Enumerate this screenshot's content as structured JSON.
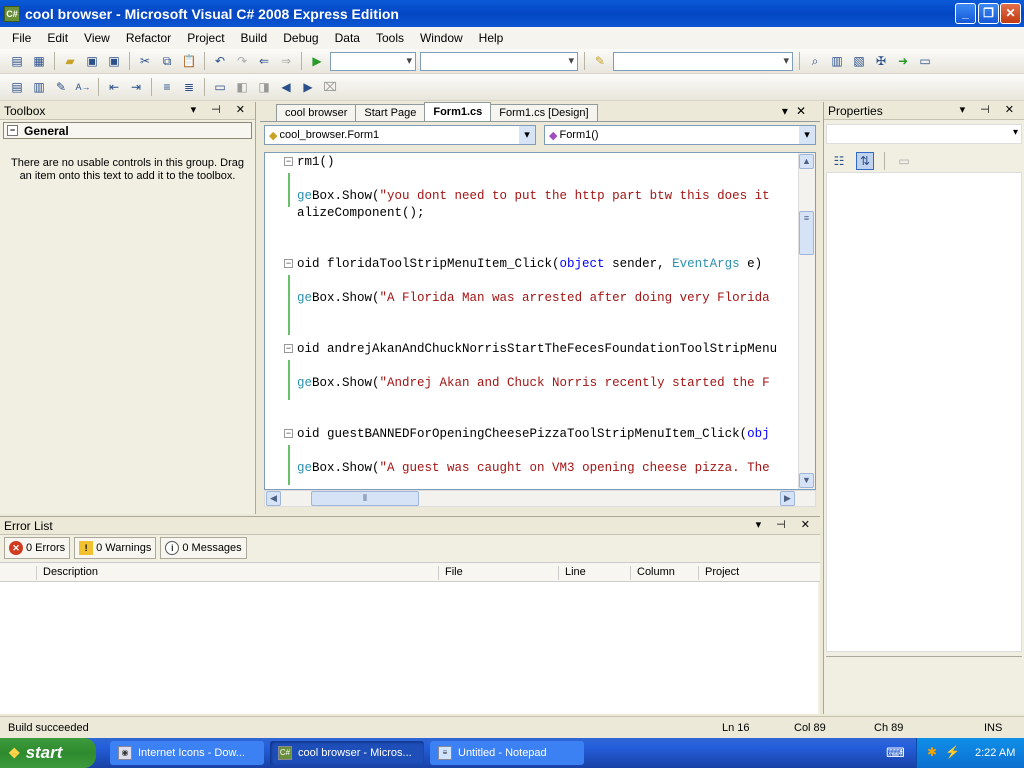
{
  "window": {
    "title": "cool browser - Microsoft Visual C# 2008 Express Edition",
    "app_icon": "csharp-icon"
  },
  "menu": [
    "File",
    "Edit",
    "View",
    "Refactor",
    "Project",
    "Build",
    "Debug",
    "Data",
    "Tools",
    "Window",
    "Help"
  ],
  "toolbox": {
    "title": "Toolbox",
    "group": "General",
    "message": "There are no usable controls in this group. Drag an item onto this text to add it to the toolbox."
  },
  "tabs": [
    "cool browser",
    "Start Page",
    "Form1.cs",
    "Form1.cs [Design]"
  ],
  "active_tab": "Form1.cs",
  "nav": {
    "class": "cool_browser.Form1",
    "member": "Form1()"
  },
  "code": [
    {
      "t": "rm1()"
    },
    {
      "t": ""
    },
    {
      "parts": [
        [
          "ty",
          "ge"
        ],
        [
          "",
          "Box.Show("
        ],
        [
          "st",
          "\"you dont need to put the http part btw this does it"
        ]
      ]
    },
    {
      "t": "alizeComponent();"
    },
    {
      "t": ""
    },
    {
      "t": ""
    },
    {
      "parts": [
        [
          "",
          "oid floridaToolStripMenuItem_Click("
        ],
        [
          "kw",
          "object"
        ],
        [
          "",
          " sender, "
        ],
        [
          "ty",
          "EventArgs"
        ],
        [
          "",
          " e)"
        ]
      ]
    },
    {
      "t": ""
    },
    {
      "parts": [
        [
          "ty",
          "ge"
        ],
        [
          "",
          "Box.Show("
        ],
        [
          "st",
          "\"A Florida Man was arrested after doing very Florida"
        ]
      ]
    },
    {
      "t": ""
    },
    {
      "t": ""
    },
    {
      "t": "oid andrejAkanAndChuckNorrisStartTheFecesFoundationToolStripMenu"
    },
    {
      "t": ""
    },
    {
      "parts": [
        [
          "ty",
          "ge"
        ],
        [
          "",
          "Box.Show("
        ],
        [
          "st",
          "\"Andrej Akan and Chuck Norris recently started the F"
        ]
      ]
    },
    {
      "t": ""
    },
    {
      "t": ""
    },
    {
      "parts": [
        [
          "",
          "oid guestBANNEDForOpeningCheesePizzaToolStripMenuItem_Click("
        ],
        [
          "kw",
          "obj"
        ]
      ]
    },
    {
      "t": ""
    },
    {
      "parts": [
        [
          "ty",
          "ge"
        ],
        [
          "",
          "Box.Show("
        ],
        [
          "st",
          "\"A guest was caught on VM3 opening cheese pizza. The"
        ]
      ]
    }
  ],
  "properties": {
    "title": "Properties"
  },
  "errorlist": {
    "title": "Error List",
    "errors": "0 Errors",
    "warnings": "0 Warnings",
    "messages": "0 Messages",
    "columns": [
      "Description",
      "File",
      "Line",
      "Column",
      "Project"
    ]
  },
  "status": {
    "text": "Build succeeded",
    "ln": "Ln 16",
    "col": "Col 89",
    "ch": "Ch 89",
    "mode": "INS"
  },
  "taskbar": {
    "start": "start",
    "tasks": [
      "Internet Icons - Dow...",
      "cool browser - Micros...",
      "Untitled - Notepad"
    ],
    "time": "2:22 AM"
  }
}
